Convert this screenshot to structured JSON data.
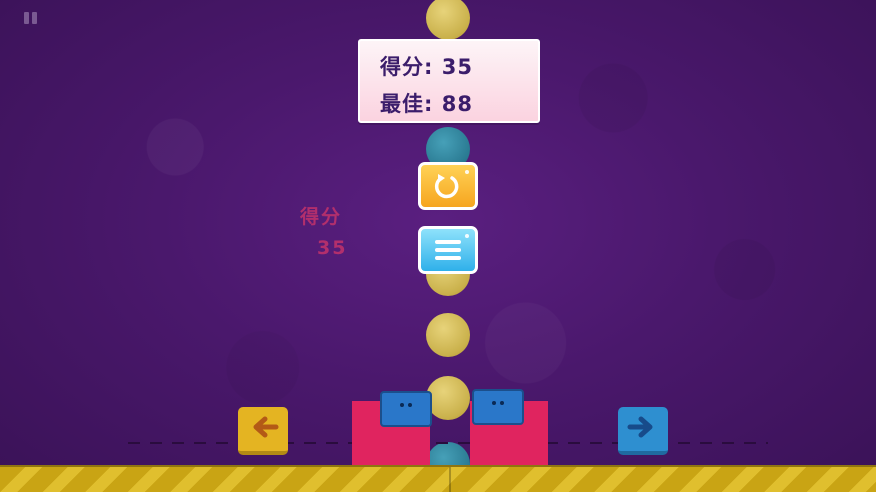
{
  "game": {
    "score_panel": {
      "score_label": "得分: 35",
      "best_label": "最佳: 88"
    },
    "floating_score": {
      "label": "得分",
      "value": "35"
    },
    "controls": {
      "pause_icon": "pause-icon",
      "restart_icon": "restart-icon",
      "menu_icon": "menu-icon",
      "left_icon": "arrow-left-icon",
      "right_icon": "arrow-right-icon"
    },
    "colors": {
      "background": "#4a186c",
      "panel_text": "#3b1d6b",
      "restart_button": "#f6a51f",
      "menu_button": "#2fb0ea",
      "left_pad": "#e4b422",
      "right_pad": "#2e8fd0",
      "block": "#e0245f",
      "paddle": "#2a77c9",
      "ground": "#c9a414",
      "floating_score": "#c3336b"
    }
  }
}
